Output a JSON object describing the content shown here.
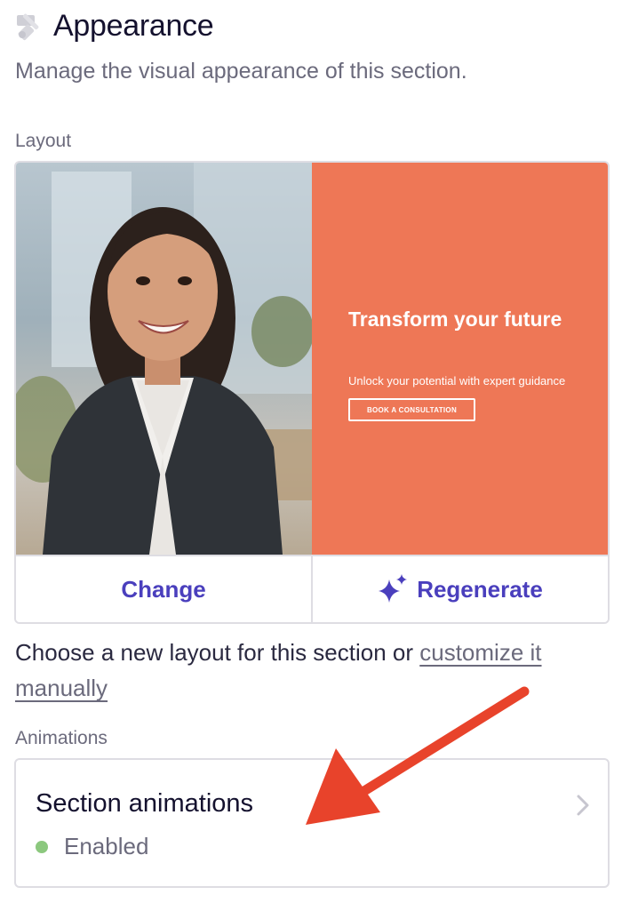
{
  "header": {
    "title": "Appearance",
    "subtitle": "Manage the visual appearance of this section.",
    "icon": "paint-roller-icon"
  },
  "layout": {
    "label": "Layout",
    "preview": {
      "hero_title": "Transform your future",
      "hero_subtitle": "Unlock your potential with expert guidance",
      "hero_button": "BOOK A CONSULTATION",
      "panel_color": "#ee7756"
    },
    "change_label": "Change",
    "regenerate_label": "Regenerate",
    "help_text": "Choose a new layout for this section or ",
    "help_link": "customize it manually"
  },
  "animations": {
    "label": "Animations",
    "card_title": "Section animations",
    "status": "Enabled",
    "status_color": "#8cc87e"
  },
  "colors": {
    "accent": "#4a3fbd",
    "annotation_arrow": "#e8432b"
  }
}
